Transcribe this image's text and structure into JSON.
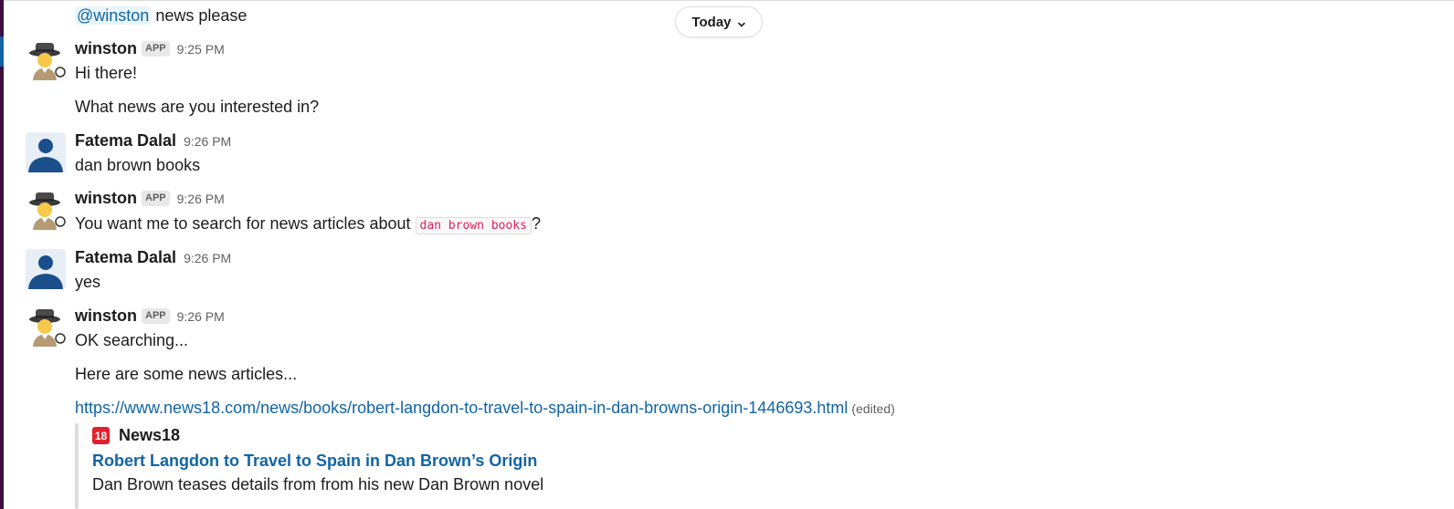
{
  "date_divider": {
    "label": "Today",
    "icon": "chevron-down-icon"
  },
  "colors": {
    "sidebar": "#3f0e40",
    "link": "#1264a3",
    "code_text": "#e01e5a",
    "news_brand": "#e4202d"
  },
  "messages": [
    {
      "type": "continuation",
      "mention": "@winston",
      "text": " news please"
    },
    {
      "author": "winston",
      "badge": "APP",
      "time": "9:25 PM",
      "avatar": "detective-avatar-icon",
      "lines": [
        "Hi there!",
        "What news are you interested in?"
      ]
    },
    {
      "author": "Fatema Dalal",
      "time": "9:26 PM",
      "avatar": "user-avatar-icon",
      "lines": [
        "dan brown books"
      ]
    },
    {
      "author": "winston",
      "badge": "APP",
      "time": "9:26 PM",
      "avatar": "detective-avatar-icon",
      "text_before": "You want me to search for news articles about ",
      "code": "dan brown books",
      "text_after": "?"
    },
    {
      "author": "Fatema Dalal",
      "time": "9:26 PM",
      "avatar": "user-avatar-icon",
      "lines": [
        "yes"
      ]
    },
    {
      "author": "winston",
      "badge": "APP",
      "time": "9:26 PM",
      "avatar": "detective-avatar-icon",
      "lines": [
        "OK searching...",
        "Here are some news articles..."
      ],
      "link": "https://www.news18.com/news/books/robert-langdon-to-travel-to-spain-in-dan-browns-origin-1446693.html",
      "edited": "(edited)",
      "unfurl": {
        "source_icon_text": "18",
        "source": "News18",
        "title": "Robert Langdon to Travel to Spain in Dan Brown’s Origin",
        "description": "Dan Brown teases details from from his new Dan Brown novel"
      }
    }
  ]
}
